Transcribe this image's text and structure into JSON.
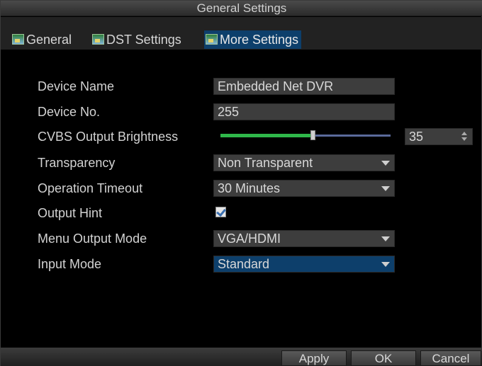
{
  "window": {
    "title": "General Settings"
  },
  "tabs": [
    {
      "label": "General",
      "active": false
    },
    {
      "label": "DST Settings",
      "active": false
    },
    {
      "label": "More Settings",
      "active": true
    }
  ],
  "settings": {
    "device_name": {
      "label": "Device Name",
      "value": "Embedded Net DVR"
    },
    "device_no": {
      "label": "Device No.",
      "value": "255"
    },
    "brightness": {
      "label": "CVBS Output Brightness",
      "value": "35",
      "level": 0.54
    },
    "transparency": {
      "label": "Transparency",
      "value": "Non Transparent"
    },
    "timeout": {
      "label": "Operation Timeout",
      "value": "30 Minutes"
    },
    "output_hint": {
      "label": "Output Hint",
      "checked": true
    },
    "menu_output": {
      "label": "Menu Output Mode",
      "value": "VGA/HDMI"
    },
    "input_mode": {
      "label": "Input Mode",
      "value": "Standard"
    }
  },
  "buttons": {
    "apply": "Apply",
    "ok": "OK",
    "cancel": "Cancel"
  },
  "colors": {
    "selected": "#0d3f6b",
    "slider_fill": "#2fb84a",
    "background": "#000000"
  }
}
